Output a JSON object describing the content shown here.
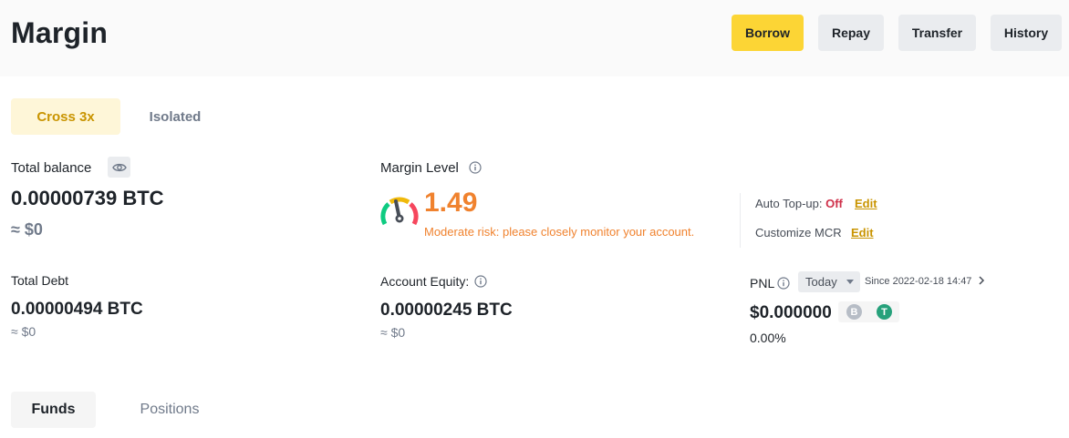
{
  "header": {
    "title": "Margin",
    "buttons": {
      "borrow": "Borrow",
      "repay": "Repay",
      "transfer": "Transfer",
      "history": "History"
    }
  },
  "mode_tabs": {
    "cross": "Cross 3x",
    "isolated": "Isolated",
    "active": "cross"
  },
  "total_balance": {
    "label": "Total balance",
    "value": "0.00000739 BTC",
    "approx": "≈ $0"
  },
  "margin_level": {
    "label": "Margin Level",
    "value": "1.49",
    "risk_text": "Moderate risk: please closely monitor your account.",
    "gauge_level": "moderate"
  },
  "auto_topup": {
    "label": "Auto Top-up:",
    "status": "Off",
    "edit": "Edit"
  },
  "customize_mcr": {
    "label": "Customize MCR",
    "edit": "Edit"
  },
  "total_debt": {
    "label": "Total Debt",
    "value": "0.00000494 BTC",
    "approx": "≈ $0"
  },
  "account_equity": {
    "label": "Account Equity:",
    "value": "0.00000245 BTC",
    "approx": "≈ $0"
  },
  "pnl": {
    "label": "PNL",
    "period": "Today",
    "since": "Since 2022-02-18 14:47",
    "value": "$0.000000",
    "percent": "0.00%",
    "coins": [
      "B",
      "T"
    ]
  },
  "bottom_tabs": {
    "funds": "Funds",
    "positions": "Positions",
    "active": "funds"
  },
  "colors": {
    "accent": "#fcd535",
    "accent_text": "#c99400",
    "warning": "#f0822e",
    "danger": "#cf304a",
    "muted": "#707a8a",
    "btc_coin": "#b7bdc6",
    "usdt_coin": "#26a17b"
  },
  "icons": [
    "eye-icon",
    "info-icon",
    "gauge-icon",
    "chevron-right-icon",
    "chevron-down-icon",
    "btc-coin-icon",
    "usdt-coin-icon"
  ]
}
